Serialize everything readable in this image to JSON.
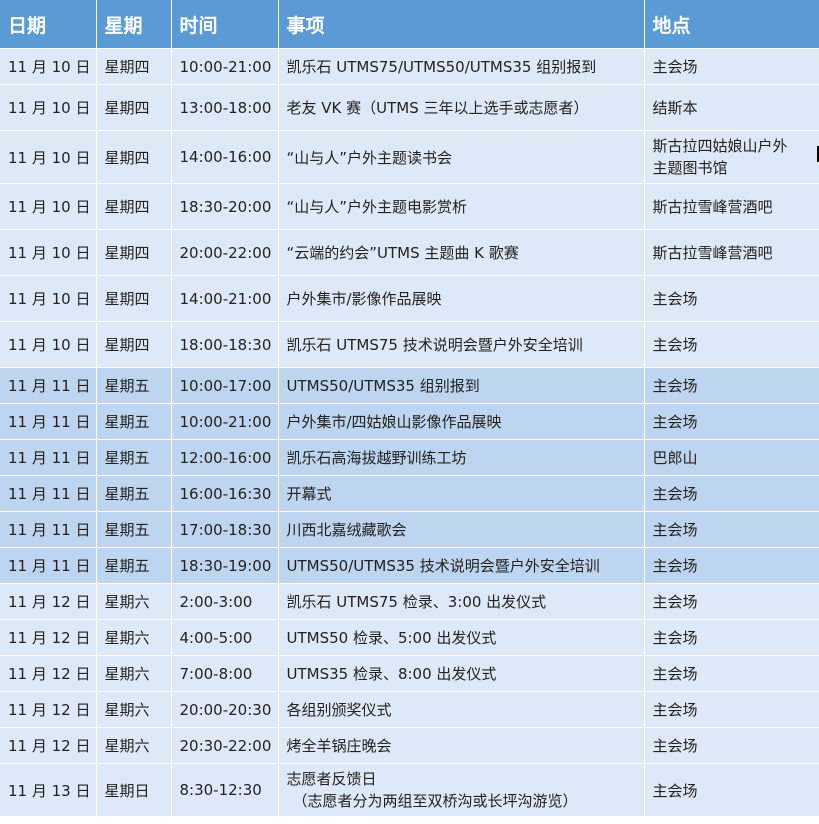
{
  "colors": {
    "header_bg": "#5b9bd5",
    "row_light": "#dde9f6",
    "row_mid": "#bdd5ee"
  },
  "headers": {
    "date": "日期",
    "weekday": "星期",
    "time": "时间",
    "event": "事项",
    "place": "地点"
  },
  "rows": [
    {
      "date": "11 月 10 日",
      "weekday": "星期四",
      "time": "10:00-21:00",
      "event": "凯乐石 UTMS75/UTMS50/UTMS35  组别报到",
      "place": "主会场"
    },
    {
      "date": "11 月 10 日",
      "weekday": "星期四",
      "time": "13:00-18:00",
      "event": "老友 VK 赛（UTMS 三年以上选手或志愿者）",
      "place": "结斯本"
    },
    {
      "date": "11 月 10 日",
      "weekday": "星期四",
      "time": "14:00-16:00",
      "event": "“山与人”户外主题读书会",
      "place_line1": "斯古拉四姑娘山户外",
      "place_line2": "主题图书馆"
    },
    {
      "date": "11 月 10 日",
      "weekday": "星期四",
      "time": "18:30-20:00",
      "event": "“山与人”户外主题电影赏析",
      "place": "斯古拉雪峰营酒吧"
    },
    {
      "date": "11 月 10 日",
      "weekday": "星期四",
      "time": "20:00-22:00",
      "event": "“云端的约会”UTMS 主题曲 K 歌赛",
      "place": "斯古拉雪峰营酒吧"
    },
    {
      "date": "11 月 10 日",
      "weekday": "星期四",
      "time": "14:00-21:00",
      "event": "户外集市/影像作品展映",
      "place": "主会场"
    },
    {
      "date": "11 月 10 日",
      "weekday": "星期四",
      "time": "18:00-18:30",
      "event": "凯乐石 UTMS75 技术说明会暨户外安全培训",
      "place": "主会场"
    },
    {
      "date": "11 月 11 日",
      "weekday": "星期五",
      "time": "10:00-17:00",
      "event": "UTMS50/UTMS35  组别报到",
      "place": "主会场"
    },
    {
      "date": "11 月 11 日",
      "weekday": "星期五",
      "time": "10:00-21:00",
      "event": "户外集市/四姑娘山影像作品展映",
      "place": "主会场"
    },
    {
      "date": "11 月 11 日",
      "weekday": "星期五",
      "time": "12:00-16:00",
      "event": "凯乐石高海拔越野训练工坊",
      "place": "巴郎山"
    },
    {
      "date": "11 月 11 日",
      "weekday": "星期五",
      "time": "16:00-16:30",
      "event": "开幕式",
      "place": "主会场"
    },
    {
      "date": "11 月 11 日",
      "weekday": "星期五",
      "time": "17:00-18:30",
      "event": "川西北嘉绒藏歌会",
      "place": "主会场"
    },
    {
      "date": "11 月 11 日",
      "weekday": "星期五",
      "time": "18:30-19:00",
      "event": "UTMS50/UTMS35 技术说明会暨户外安全培训",
      "place": "主会场"
    },
    {
      "date": "11 月 12 日",
      "weekday": "星期六",
      "time": "2:00-3:00",
      "event": "凯乐石 UTMS75 检录、3:00  出发仪式",
      "place": "主会场"
    },
    {
      "date": "11 月 12 日",
      "weekday": "星期六",
      "time": "4:00-5:00",
      "event": "UTMS50  检录、5:00  出发仪式",
      "place": "主会场"
    },
    {
      "date": "11 月 12 日",
      "weekday": "星期六",
      "time": "7:00-8:00",
      "event": "UTMS35  检录、8:00  出发仪式",
      "place": "主会场"
    },
    {
      "date": "11 月 12 日",
      "weekday": "星期六",
      "time": "20:00-20:30",
      "event": "各组别颁奖仪式",
      "place": "主会场"
    },
    {
      "date": "11 月 12 日",
      "weekday": "星期六",
      "time": "20:30-22:00",
      "event": "烤全羊锅庄晚会",
      "place": "主会场"
    },
    {
      "date": "11 月 13 日",
      "weekday": "星期日",
      "time": "8:30-12:30",
      "event_line1": "志愿者反馈日",
      "event_line2": "（志愿者分为两组至双桥沟或长坪沟游览）",
      "place": "主会场"
    }
  ]
}
